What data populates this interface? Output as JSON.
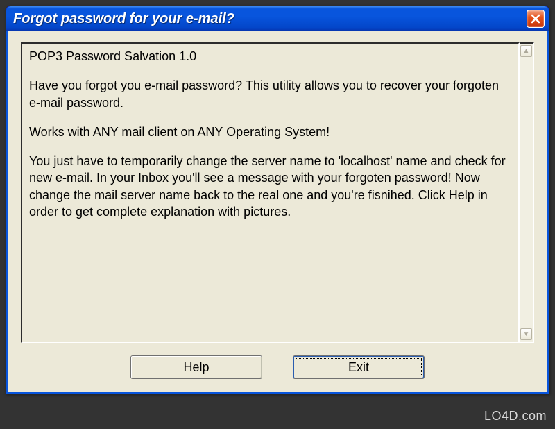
{
  "window": {
    "title": "Forgot password for your e-mail?"
  },
  "content": {
    "p1": "POP3 Password Salvation 1.0",
    "p2": "Have you forgot you e-mail password? This utility allows you to recover your forgoten e-mail password.",
    "p3": "Works with ANY mail client on ANY Operating System!",
    "p4": "You just have to temporarily change the server name to 'localhost' name and check for new e-mail. In your Inbox you'll see a message with your forgoten password! Now change the mail server name back to the real one and you're fisnihed. Click Help in order to get complete explanation with pictures."
  },
  "buttons": {
    "help": "Help",
    "exit": "Exit"
  },
  "watermark": "LO4D.com",
  "icons": {
    "close": "close-icon",
    "scroll_up": "▲",
    "scroll_down": "▼"
  }
}
